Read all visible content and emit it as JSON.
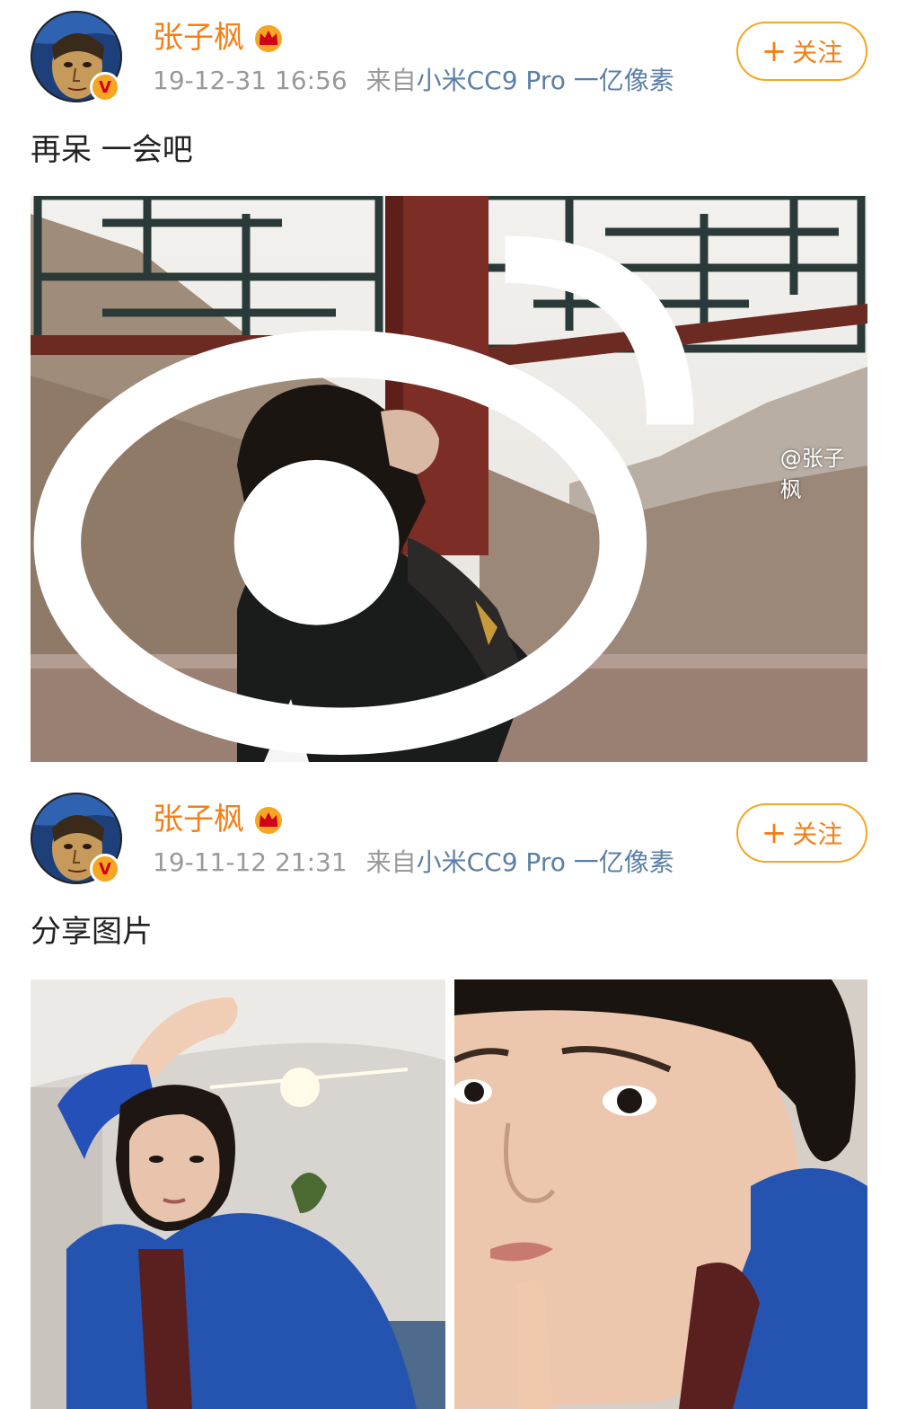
{
  "posts": [
    {
      "username": "张子枫",
      "timestamp": "19-12-31 16:56",
      "source_prefix": "来自",
      "device": "小米CC9 Pro 一亿像素",
      "follow_label": "关注",
      "text": "再呆 一会吧",
      "watermark": "@张子枫",
      "images": [
        "landscape-pavilion-photo"
      ]
    },
    {
      "username": "张子枫",
      "timestamp": "19-11-12 21:31",
      "source_prefix": "来自",
      "device": "小米CC9 Pro 一亿像素",
      "follow_label": "关注",
      "text": "分享图片",
      "images": [
        "selfie-photo-1",
        "selfie-photo-2"
      ]
    }
  ],
  "icons": {
    "verified": "verified-v-badge-icon",
    "vip": "crown-icon",
    "plus": "plus-icon",
    "weibo": "weibo-logo-icon"
  },
  "colors": {
    "accent": "#f57f17",
    "meta_gray": "#999999",
    "device_blue": "#5b7fa6",
    "follow_border": "#f5a623"
  }
}
